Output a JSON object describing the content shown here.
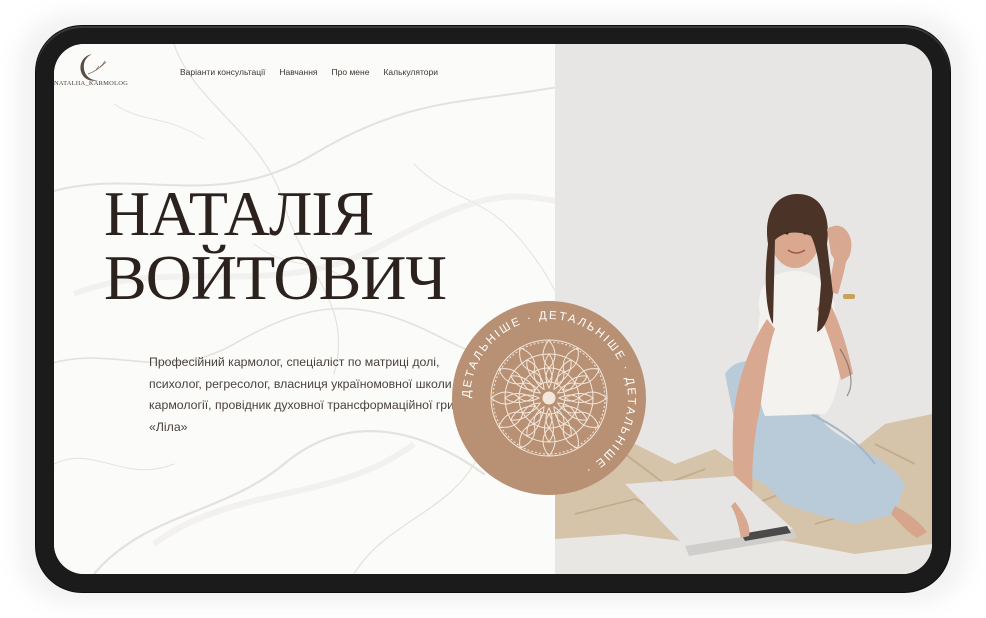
{
  "logo": {
    "text": "NATALIIA_KARMOLOG"
  },
  "nav": {
    "items": [
      "Варіанти консультації",
      "Навчання",
      "Про мене",
      "Калькулятори"
    ]
  },
  "hero": {
    "title_line1": "НАТАЛІЯ",
    "title_line2": "ВОЙТОВИЧ",
    "description": "Професійний кармолог, спеціаліст по матриці долі, психолог, регресолог, власниця україномовної школи кармології, провідник духовної трансформаційної гри «Ліла»"
  },
  "badge": {
    "label": "ДЕТАЛЬНІШЕ"
  },
  "colors": {
    "accent": "#b89174",
    "title": "#2c221d",
    "text": "#4a423d"
  }
}
